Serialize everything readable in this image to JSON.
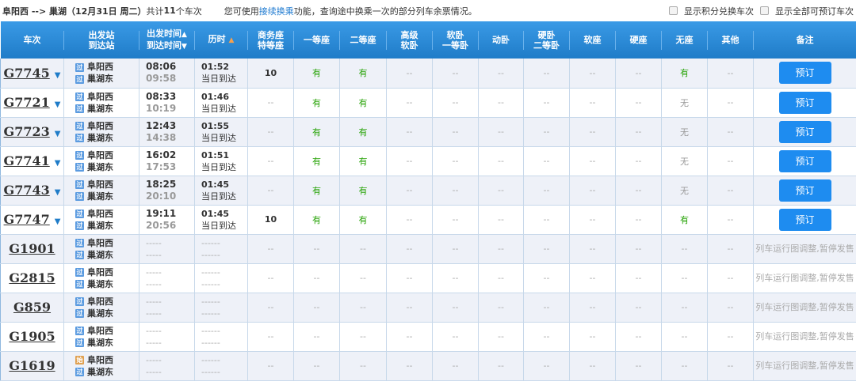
{
  "header": {
    "route": "阜阳西 --> 巢湖",
    "date": "（12月31日  周二）",
    "count_prefix": "共计",
    "count": "11",
    "count_suffix": "个车次",
    "tip_before": "您可使用",
    "tip_link": "接续换乘",
    "tip_after": "功能，查询途中换乘一次的部分列车余票情况。",
    "opt1": "显示积分兑换车次",
    "opt2": "显示全部可预订车次"
  },
  "columns": {
    "train": "车次",
    "station1": "出发站",
    "station2": "到达站",
    "time1": "出发时间",
    "time2": "到达时间",
    "duration": "历时",
    "seats": [
      [
        "商务座",
        "特等座"
      ],
      [
        "一等座"
      ],
      [
        "二等座"
      ],
      [
        "高级",
        "软卧"
      ],
      [
        "软卧",
        "一等卧"
      ],
      [
        "动卧"
      ],
      [
        "硬卧",
        "二等卧"
      ],
      [
        "软座"
      ],
      [
        "硬座"
      ],
      [
        "无座"
      ],
      [
        "其他"
      ]
    ],
    "remark": "备注"
  },
  "book_label": "预订",
  "rows": [
    {
      "train": "G7745",
      "expand": true,
      "from_badge": "过",
      "from": "阜阳西",
      "to_badge": "过",
      "to": "巢湖东",
      "dep": "08:06",
      "arr": "09:58",
      "dur": "01:52",
      "note": "当日到达",
      "seats": [
        "10",
        "有",
        "有",
        "--",
        "--",
        "--",
        "--",
        "--",
        "--",
        "有",
        "--"
      ],
      "remark": null
    },
    {
      "train": "G7721",
      "expand": true,
      "from_badge": "过",
      "from": "阜阳西",
      "to_badge": "过",
      "to": "巢湖东",
      "dep": "08:33",
      "arr": "10:19",
      "dur": "01:46",
      "note": "当日到达",
      "seats": [
        "--",
        "有",
        "有",
        "--",
        "--",
        "--",
        "--",
        "--",
        "--",
        "无",
        "--"
      ],
      "remark": null
    },
    {
      "train": "G7723",
      "expand": true,
      "from_badge": "过",
      "from": "阜阳西",
      "to_badge": "过",
      "to": "巢湖东",
      "dep": "12:43",
      "arr": "14:38",
      "dur": "01:55",
      "note": "当日到达",
      "seats": [
        "--",
        "有",
        "有",
        "--",
        "--",
        "--",
        "--",
        "--",
        "--",
        "无",
        "--"
      ],
      "remark": null
    },
    {
      "train": "G7741",
      "expand": true,
      "from_badge": "过",
      "from": "阜阳西",
      "to_badge": "过",
      "to": "巢湖东",
      "dep": "16:02",
      "arr": "17:53",
      "dur": "01:51",
      "note": "当日到达",
      "seats": [
        "--",
        "有",
        "有",
        "--",
        "--",
        "--",
        "--",
        "--",
        "--",
        "无",
        "--"
      ],
      "remark": null
    },
    {
      "train": "G7743",
      "expand": true,
      "from_badge": "过",
      "from": "阜阳西",
      "to_badge": "过",
      "to": "巢湖东",
      "dep": "18:25",
      "arr": "20:10",
      "dur": "01:45",
      "note": "当日到达",
      "seats": [
        "--",
        "有",
        "有",
        "--",
        "--",
        "--",
        "--",
        "--",
        "--",
        "无",
        "--"
      ],
      "remark": null
    },
    {
      "train": "G7747",
      "expand": true,
      "from_badge": "过",
      "from": "阜阳西",
      "to_badge": "过",
      "to": "巢湖东",
      "dep": "19:11",
      "arr": "20:56",
      "dur": "01:45",
      "note": "当日到达",
      "seats": [
        "10",
        "有",
        "有",
        "--",
        "--",
        "--",
        "--",
        "--",
        "--",
        "有",
        "--"
      ],
      "remark": null
    },
    {
      "train": "G1901",
      "expand": false,
      "from_badge": "过",
      "from": "阜阳西",
      "to_badge": "过",
      "to": "巢湖东",
      "dep": "-----",
      "arr": "-----",
      "dur": "------",
      "note": "------",
      "seats": [
        "--",
        "--",
        "--",
        "--",
        "--",
        "--",
        "--",
        "--",
        "--",
        "--",
        "--"
      ],
      "remark": "列车运行图调整,暂停发售"
    },
    {
      "train": "G2815",
      "expand": false,
      "from_badge": "过",
      "from": "阜阳西",
      "to_badge": "过",
      "to": "巢湖东",
      "dep": "-----",
      "arr": "-----",
      "dur": "------",
      "note": "------",
      "seats": [
        "--",
        "--",
        "--",
        "--",
        "--",
        "--",
        "--",
        "--",
        "--",
        "--",
        "--"
      ],
      "remark": "列车运行图调整,暂停发售"
    },
    {
      "train": "G859",
      "expand": false,
      "from_badge": "过",
      "from": "阜阳西",
      "to_badge": "过",
      "to": "巢湖东",
      "dep": "-----",
      "arr": "-----",
      "dur": "------",
      "note": "------",
      "seats": [
        "--",
        "--",
        "--",
        "--",
        "--",
        "--",
        "--",
        "--",
        "--",
        "--",
        "--"
      ],
      "remark": "列车运行图调整,暂停发售"
    },
    {
      "train": "G1905",
      "expand": false,
      "from_badge": "过",
      "from": "阜阳西",
      "to_badge": "过",
      "to": "巢湖东",
      "dep": "-----",
      "arr": "-----",
      "dur": "------",
      "note": "------",
      "seats": [
        "--",
        "--",
        "--",
        "--",
        "--",
        "--",
        "--",
        "--",
        "--",
        "--",
        "--"
      ],
      "remark": "列车运行图调整,暂停发售"
    },
    {
      "train": "G1619",
      "expand": false,
      "from_badge": "始",
      "from": "阜阳西",
      "to_badge": "过",
      "to": "巢湖东",
      "dep": "-----",
      "arr": "-----",
      "dur": "------",
      "note": "------",
      "seats": [
        "--",
        "--",
        "--",
        "--",
        "--",
        "--",
        "--",
        "--",
        "--",
        "--",
        "--"
      ],
      "remark": "列车运行图调整,暂停发售"
    }
  ]
}
